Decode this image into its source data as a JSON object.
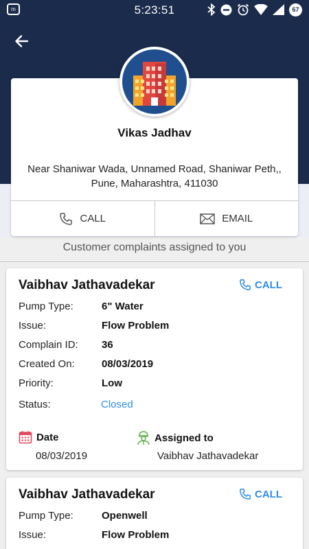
{
  "status_bar": {
    "time": "5:23:51",
    "app_icon_text": "m",
    "battery": "67"
  },
  "profile": {
    "name": "Vikas Jadhav",
    "address": "Near Shaniwar Wada, Unnamed Road, Shaniwar Peth,, Pune, Maharashtra, 411030",
    "call_label": "CALL",
    "email_label": "EMAIL",
    "icon": "building-icon"
  },
  "section_title": "Customer complaints assigned to you",
  "field_labels": {
    "pump_type": "Pump Type:",
    "issue": "Issue:",
    "complain_id": "Complain ID:",
    "created_on": "Created On:",
    "priority": "Priority:",
    "status": "Status:",
    "date": "Date",
    "assigned_to": "Assigned to",
    "call": "CALL"
  },
  "complaints": [
    {
      "customer": "Vaibhav Jathavadekar",
      "pump_type": "6\" Water",
      "issue": "Flow Problem",
      "complain_id": "36",
      "created_on": "08/03/2019",
      "priority": "Low",
      "status": "Closed",
      "date": "08/03/2019",
      "assigned_to": "Vaibhav Jathavadekar"
    },
    {
      "customer": "Vaibhav Jathavadekar",
      "pump_type": "Openwell",
      "issue": "Flow Problem"
    }
  ],
  "colors": {
    "header": "#1b2b4b",
    "accent": "#2f8ce6",
    "status_closed": "#2f8ce6",
    "calendar_icon": "#e0485b",
    "worker_icon": "#5fae45"
  }
}
